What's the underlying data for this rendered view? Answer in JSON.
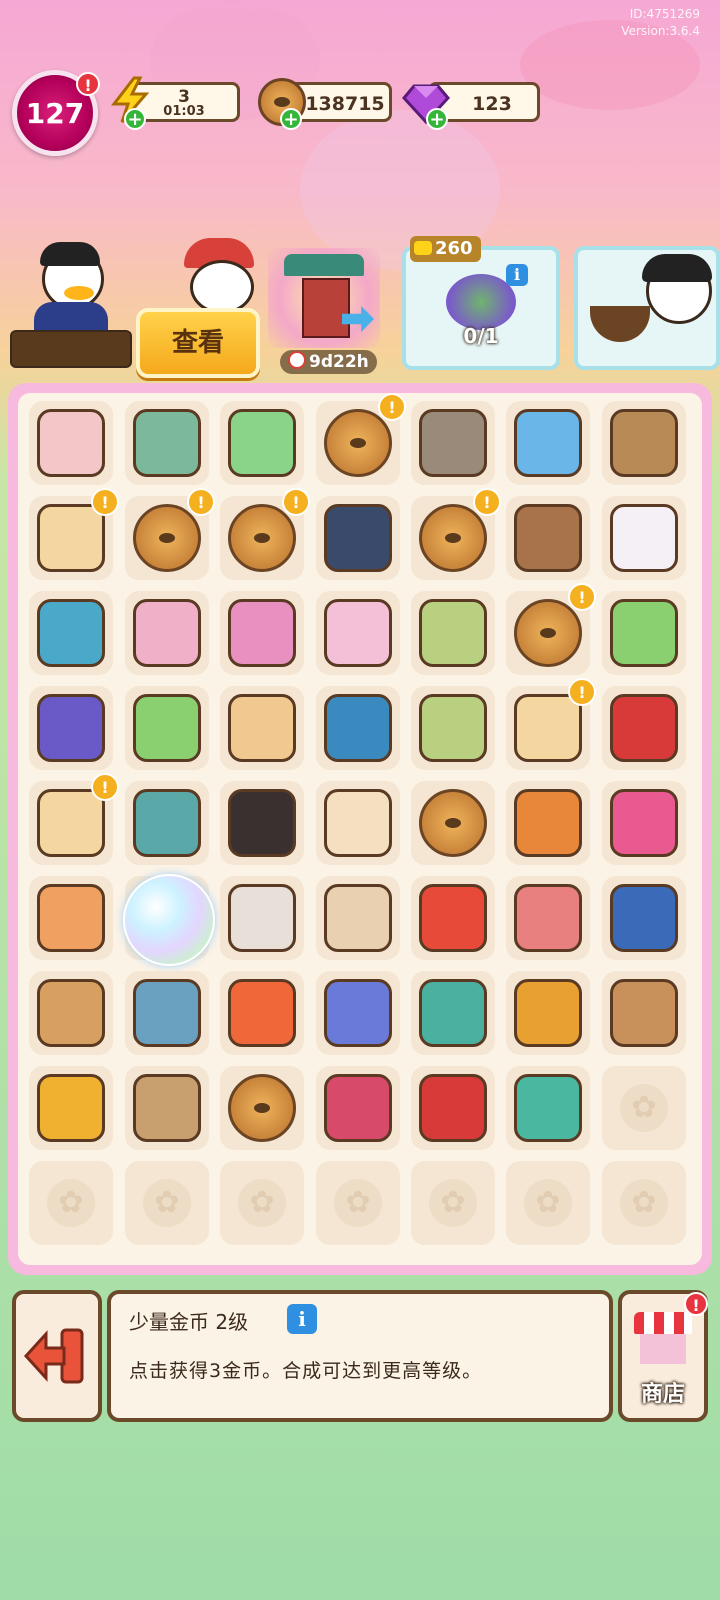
{
  "header": {
    "version_id": "ID:4751269",
    "version": "Version:3.6.4",
    "level": "127",
    "energy": {
      "value": "3",
      "timer": "01:03",
      "icon": "lightning-icon"
    },
    "coins": {
      "value": "138715",
      "icon": "coin-icon"
    },
    "gems": {
      "value": "123",
      "icon": "gem-icon"
    }
  },
  "characters": {
    "view_button": "查看",
    "event_timer": "9d22h",
    "order_reward": "260",
    "order_progress": "0/1"
  },
  "info_panel": {
    "title": "少量金币 2级",
    "description": "点击获得3金币。合成可达到更高等级。",
    "shop_label": "商店"
  },
  "colors": {
    "accent_pink": "#f7b9dd",
    "panel_border": "#6b4a2b",
    "energy_yellow": "#ffd21a",
    "gem_purple": "#b04ad8",
    "alert_red": "#e8343f"
  }
}
